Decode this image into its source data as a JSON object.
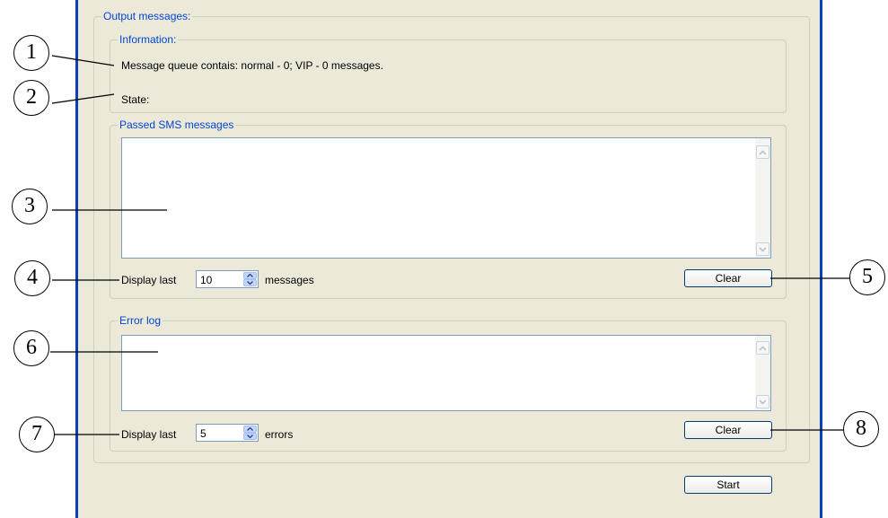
{
  "output": {
    "legend": "Output messages:",
    "information": {
      "legend": "Information:",
      "queue_text": "Message queue contais: normal - 0; VIP - 0 messages.",
      "state_text": "State:"
    },
    "passed_sms": {
      "legend": "Passed SMS messages",
      "display_last_label": "Display last",
      "display_last_value": "10",
      "unit_label": "messages",
      "clear_label": "Clear"
    },
    "error_log": {
      "legend": "Error log",
      "display_last_label": "Display last",
      "display_last_value": "5",
      "unit_label": "errors",
      "clear_label": "Clear"
    },
    "start_label": "Start"
  },
  "callouts": [
    "1",
    "2",
    "3",
    "4",
    "5",
    "6",
    "7",
    "8"
  ],
  "colors": {
    "legend_text": "#0046d5",
    "panel_bg": "#ece9d8",
    "border_accent": "#0b3fb7"
  }
}
